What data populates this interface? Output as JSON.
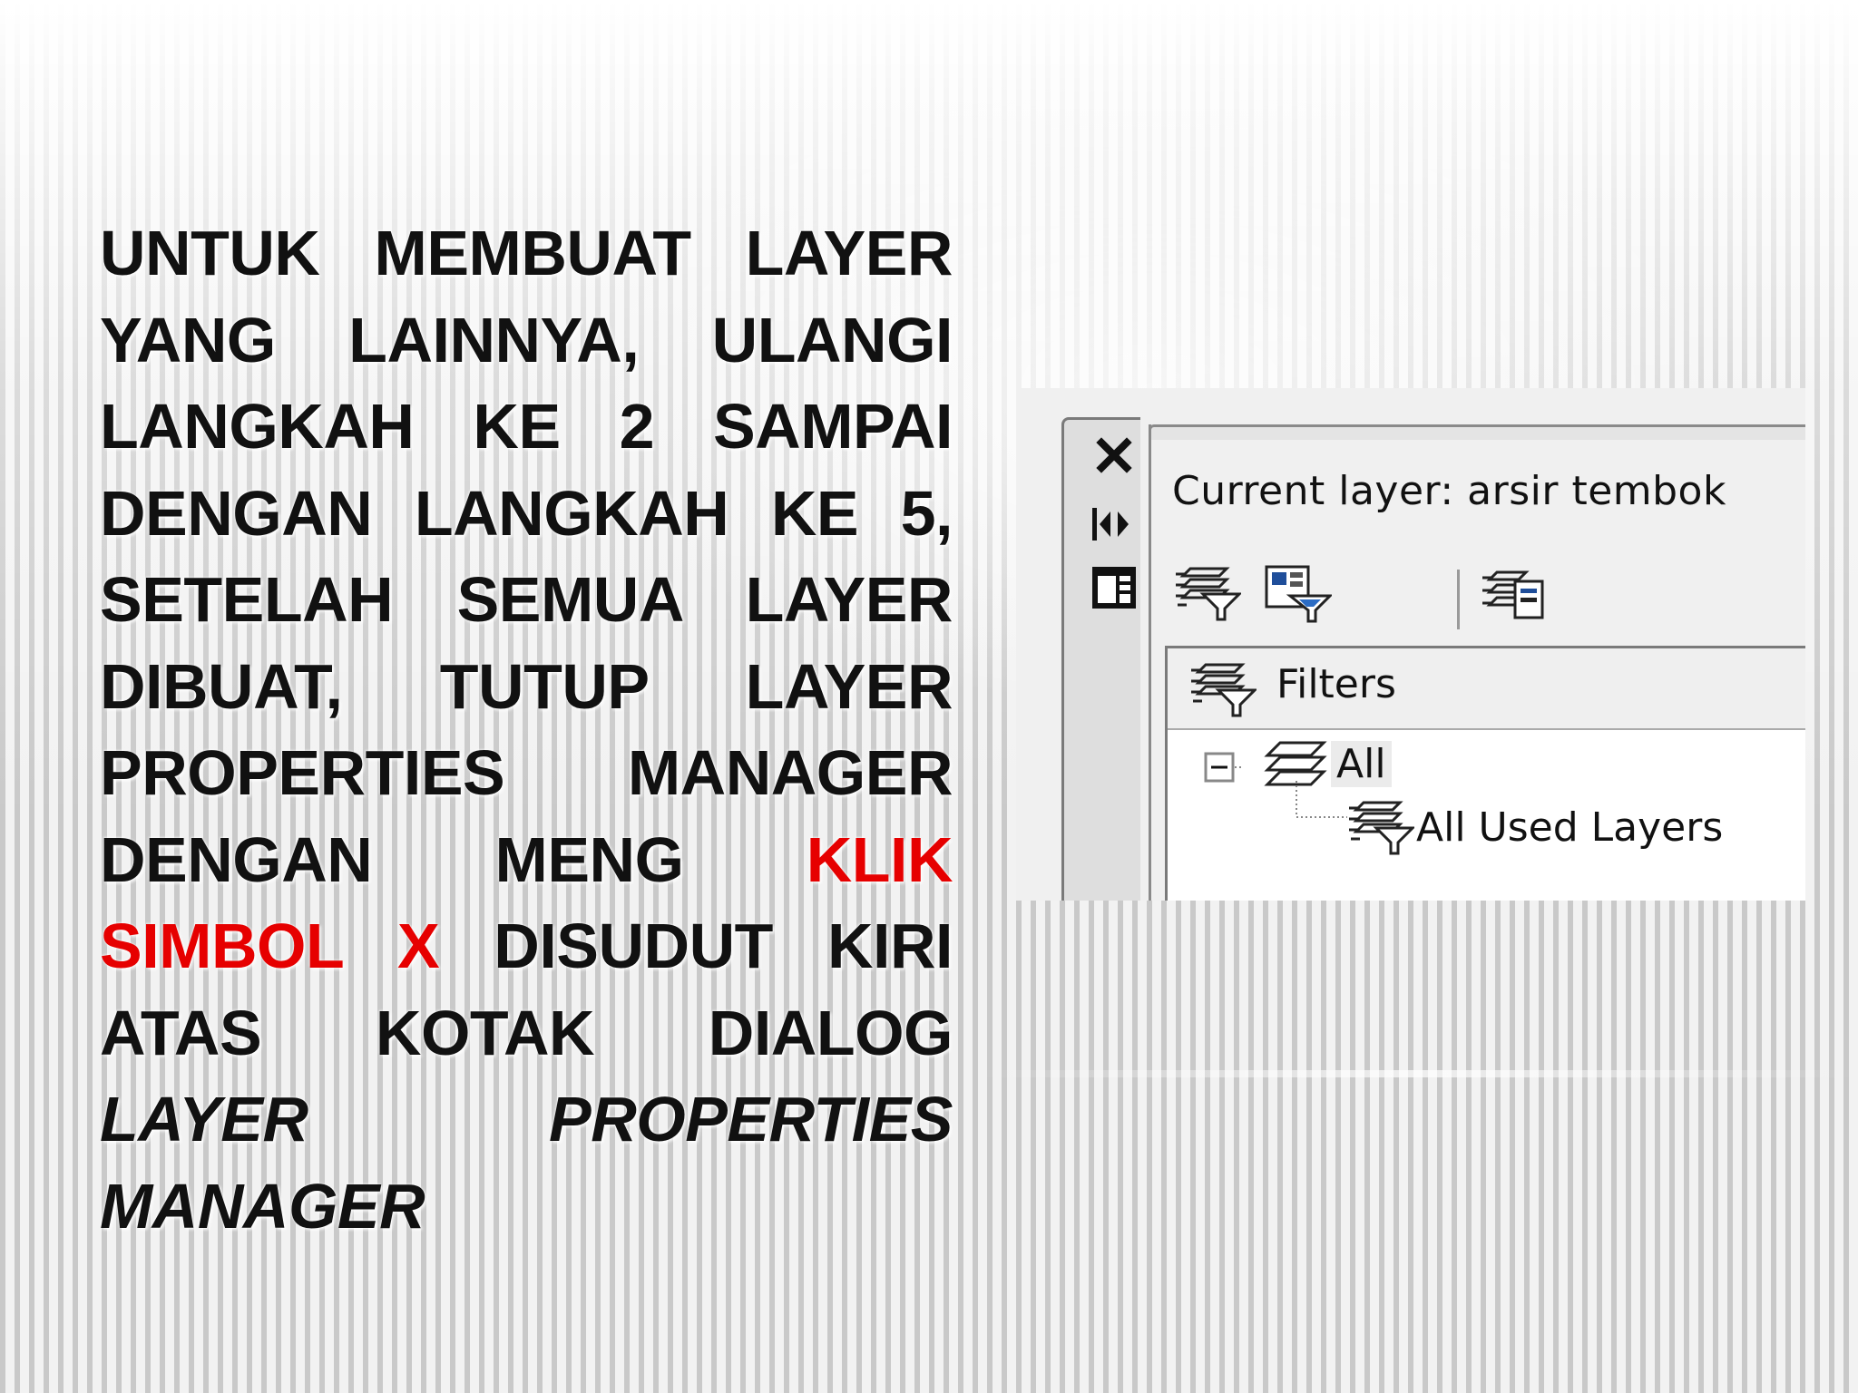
{
  "slide": {
    "segments": [
      {
        "text": "UNTUK MEMBUAT LAYER YANG LAINNYA, ULANGI LANGKAH KE 2 SAMPAI DENGAN LANGKAH KE 5, SETELAH SEMUA LAYER DIBUAT, TUTUP LAYER PROPERTIES MANAGER DENGAN MENG ",
        "style": "normal"
      },
      {
        "text": "KLIK SIMBOL X",
        "style": "red"
      },
      {
        "text": " DISUDUT KIRI ATAS KOTAK DIALOG ",
        "style": "normal"
      },
      {
        "text": "LAYER PROPERTIES MANAGER",
        "style": "italic"
      }
    ],
    "colors": {
      "text": "#111111",
      "highlight": "#e60000"
    }
  },
  "palette": {
    "current_layer": "Current layer: arsir tembok",
    "rail_icons": [
      "close-icon",
      "auto-hide-icon",
      "properties-icon"
    ],
    "toolbar_icons": [
      "new-property-filter-icon",
      "new-group-filter-icon",
      "layer-states-manager-icon"
    ],
    "tree": {
      "header": "Filters",
      "root": "All",
      "child": "All Used Layers"
    }
  }
}
